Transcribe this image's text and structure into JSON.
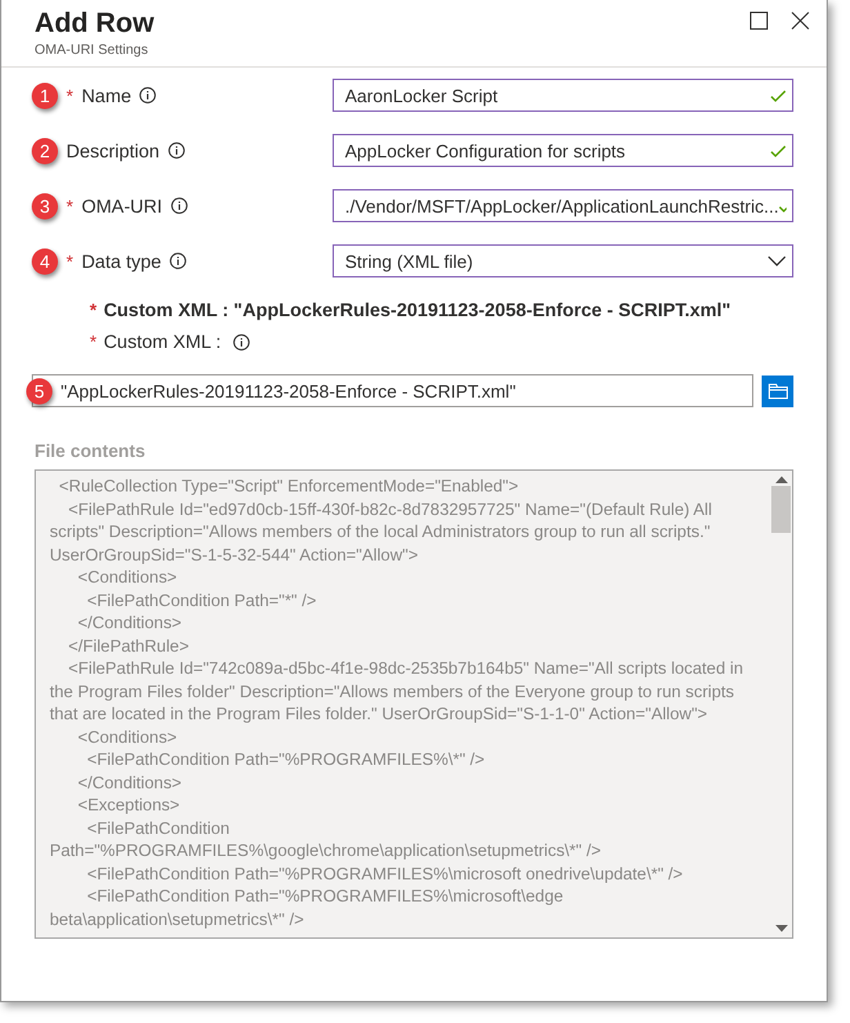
{
  "header": {
    "title": "Add Row",
    "subtitle": "OMA-URI Settings"
  },
  "fields": [
    {
      "badge": "1",
      "marker": "*",
      "label": "Name",
      "kind": "text",
      "value": "AaronLocker Script",
      "valid": true
    },
    {
      "badge": "2",
      "label": "Description",
      "kind": "text",
      "value": "AppLocker Configuration for scripts",
      "valid": true
    },
    {
      "badge": "3",
      "marker": "*",
      "label": "OMA-URI",
      "kind": "text",
      "value": "./Vendor/MSFT/AppLocker/ApplicationLaunchRestric...",
      "valid": true
    },
    {
      "badge": "4",
      "marker": "*",
      "label": "Data type",
      "kind": "select",
      "value": "String (XML file)"
    }
  ],
  "custom_xml": [
    {
      "marker": "*",
      "label": "Custom XML : \"AppLockerRules-20191123-2058-Enforce - SCRIPT.xml\""
    },
    {
      "marker": "*",
      "label": "Custom XML :",
      "info": true
    }
  ],
  "file_picker": {
    "badge": "5",
    "value": "\"AppLockerRules-20191123-2058-Enforce - SCRIPT.xml\""
  },
  "file_contents": {
    "label": "File contents",
    "lines": [
      "  <RuleCollection Type=\"Script\" EnforcementMode=\"Enabled\">",
      "    <FilePathRule Id=\"ed97d0cb-15ff-430f-b82c-8d7832957725\" Name=\"(Default Rule) All scripts\" Description=\"Allows members of the local Administrators group to run all scripts.\" UserOrGroupSid=\"S-1-5-32-544\" Action=\"Allow\">",
      "      <Conditions>",
      "        <FilePathCondition Path=\"*\" />",
      "      </Conditions>",
      "    </FilePathRule>",
      "    <FilePathRule Id=\"742c089a-d5bc-4f1e-98dc-2535b7b164b5\" Name=\"All scripts located in the Program Files folder\" Description=\"Allows members of the Everyone group to run scripts that are located in the Program Files folder.\" UserOrGroupSid=\"S-1-1-0\" Action=\"Allow\">",
      "      <Conditions>",
      "        <FilePathCondition Path=\"%PROGRAMFILES%\\*\" />",
      "      </Conditions>",
      "      <Exceptions>",
      "        <FilePathCondition Path=\"%PROGRAMFILES%\\google\\chrome\\application\\setupmetrics\\*\" />",
      "        <FilePathCondition Path=\"%PROGRAMFILES%\\microsoft onedrive\\update\\*\" />",
      "        <FilePathCondition Path=\"%PROGRAMFILES%\\microsoft\\edge beta\\application\\setupmetrics\\*\" />"
    ]
  }
}
